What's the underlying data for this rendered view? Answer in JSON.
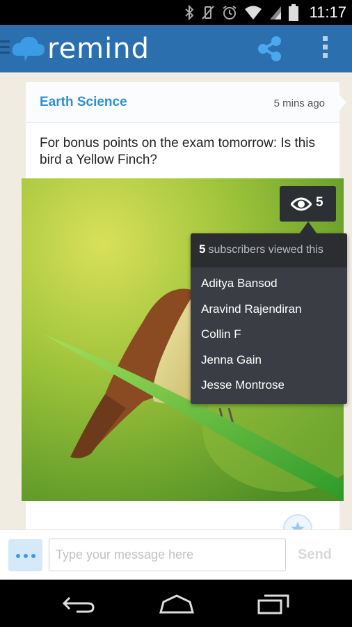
{
  "status_bar": {
    "time": "11:17",
    "icons": [
      "bluetooth-icon",
      "vibrate-icon",
      "alarm-icon",
      "wifi-icon",
      "cell-signal-icon",
      "battery-icon"
    ]
  },
  "app_bar": {
    "brand": "remind",
    "icons": [
      "menu-icon",
      "cloud-logo-icon",
      "share-icon",
      "overflow-menu-icon"
    ],
    "colors": {
      "background": "#2c6fae",
      "accent": "#3b9ce5"
    }
  },
  "post": {
    "class_name": "Earth Science",
    "timestamp": "5 mins ago",
    "message": "For bonus points on the exam tomorrow: Is this bird a Yellow Finch?",
    "view_count": "5",
    "photo_icon": "bird-photo"
  },
  "viewers_popup": {
    "count": "5",
    "label": "subscribers viewed this",
    "viewers": [
      "Aditya Bansod",
      "Aravind Rajendiran",
      "Collin F",
      "Jenna Gain",
      "Jesse Montrose"
    ]
  },
  "composer": {
    "placeholder": "Type your message here",
    "value": "",
    "send_label": "Send",
    "more_icon": "ellipsis-icon"
  },
  "nav_bar": {
    "icons": [
      "back-icon",
      "home-icon",
      "recents-icon"
    ]
  }
}
